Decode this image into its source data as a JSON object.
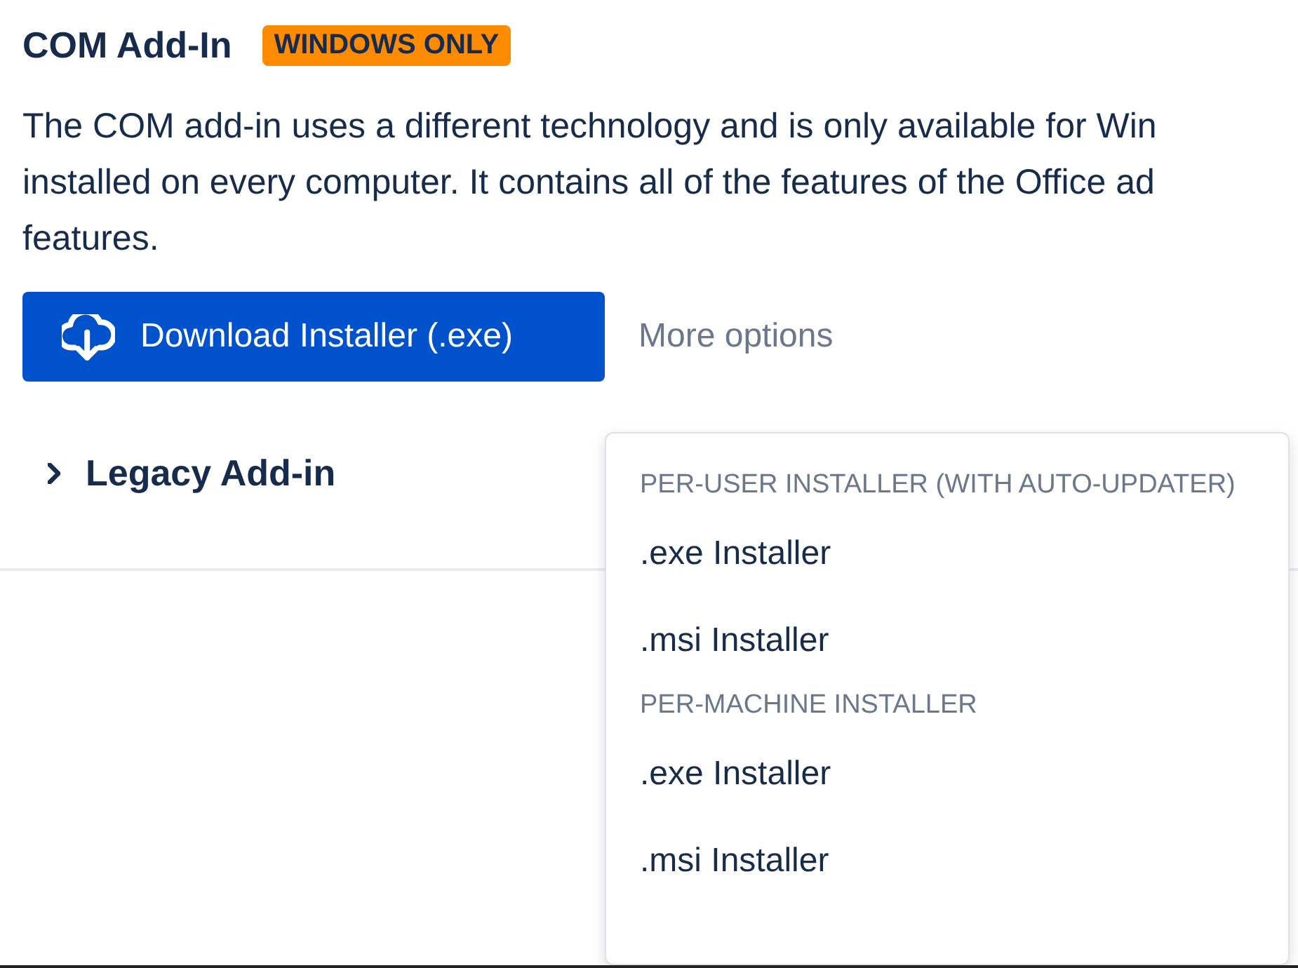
{
  "section": {
    "title": "COM Add-In",
    "badge": "WINDOWS ONLY"
  },
  "description": [
    "The COM add-in uses a different technology and is only available for Win",
    "installed on every computer. It contains all of the features of the Office ad",
    "features."
  ],
  "primary_button": {
    "label": "Download Installer (.exe)"
  },
  "secondary_link": {
    "label": "More options"
  },
  "collapsible": {
    "label": "Legacy Add-in",
    "expanded": false
  },
  "menu": {
    "groups": [
      {
        "header": "PER-USER INSTALLER (WITH AUTO-UPDATER)",
        "items": [
          ".exe Installer",
          ".msi Installer"
        ]
      },
      {
        "header": "PER-MACHINE INSTALLER",
        "items": [
          ".exe Installer",
          ".msi Installer"
        ]
      }
    ]
  }
}
